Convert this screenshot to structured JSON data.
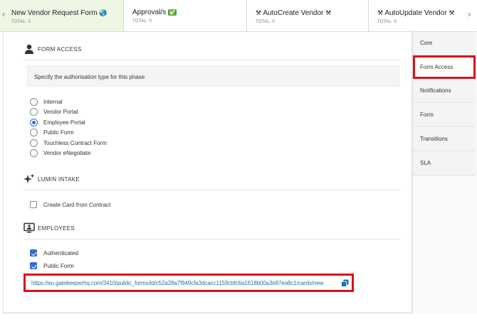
{
  "tabs": [
    {
      "title": "New Vendor Request Form",
      "emoji": "🌏",
      "total": "TOTAL: 0"
    },
    {
      "title": "Approval/s",
      "emoji": "✅",
      "total": "TOTAL: 0"
    },
    {
      "title": "AutoCreate Vendor",
      "emoji": "⚒",
      "total": "TOTAL: 0"
    },
    {
      "title": "AutoUpdate Vendor",
      "emoji": "⚒",
      "total": "TOTAL: 0"
    }
  ],
  "form_access": {
    "heading": "FORM ACCESS",
    "description": "Specify the authorisation type for this phase",
    "options": [
      "Internal",
      "Vendor Portal",
      "Employee Portal",
      "Public Form",
      "Touchless Contract Form",
      "Vendor eNegotiate"
    ],
    "selected": "Employee Portal"
  },
  "lumin_intake": {
    "heading": "LUMIN INTAKE",
    "checkbox_label": "Create Card from Contract",
    "checked": false
  },
  "employees": {
    "heading": "EMPLOYEES",
    "authenticated_label": "Authenticated",
    "authenticated_checked": true,
    "public_form_label": "Public Form",
    "public_form_checked": true,
    "url": "https://eu.gatekeeperhq.com/3410/public_forms/id/c52a28a7f949cfa3dcacc1159cbfc6a1618b00a3e97ea9c1/cards/new"
  },
  "sidebar": {
    "items": [
      "Core",
      "Form Access",
      "Notifications",
      "Form",
      "Transitions",
      "SLA"
    ],
    "highlighted": "Form Access"
  },
  "colors": {
    "accent": "#2c6fd6",
    "highlight_border": "#d9101b",
    "active_tab_bg": "#eff7e4",
    "link": "#1a73b8"
  },
  "icons": {
    "tab_prev": "chevron-left-icon",
    "tab_next": "chevron-right-icon",
    "form_access": "user-icon",
    "lumin_intake": "sparkles-icon",
    "employees": "monitor-user-icon",
    "copy": "copy-icon"
  }
}
